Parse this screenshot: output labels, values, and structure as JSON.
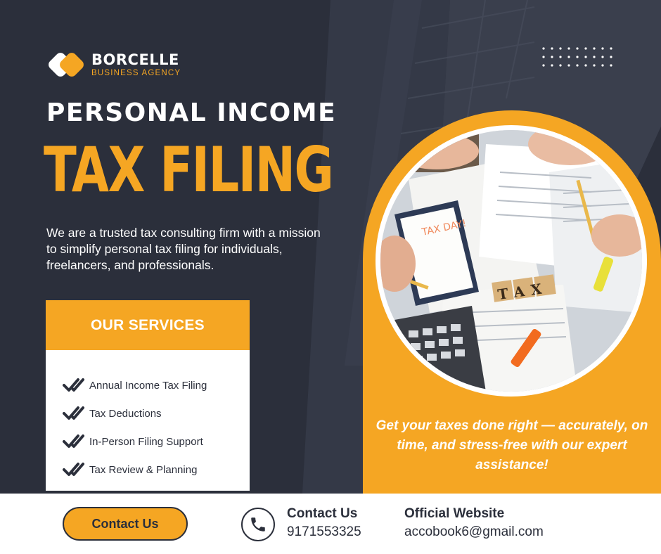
{
  "brand": {
    "name": "BORCELLE",
    "tagline": "BUSINESS AGENCY",
    "accent_color": "#f5a623",
    "dark_color": "#2b2f3b"
  },
  "hero": {
    "line1": "PERSONAL INCOME",
    "line2": "TAX FILING",
    "intro": "We are a trusted tax consulting firm with a mission to simplify personal tax filing for individuals, freelancers, and professionals."
  },
  "services": {
    "title": "OUR SERVICES",
    "items": [
      "Annual Income Tax Filing",
      "Tax Deductions",
      "In-Person Filing Support",
      "Tax Review & Planning"
    ]
  },
  "photo": {
    "tile_text": "TAX",
    "note_text": "TAX DAY!"
  },
  "tagline": "Get your taxes done right — accurately, on time, and stress-free with our expert assistance!",
  "footer": {
    "button_label": "Contact Us",
    "contact_label": "Contact Us",
    "contact_value": "9171553325",
    "website_label": "Official Website",
    "website_value": "accobook6@gmail.com"
  }
}
